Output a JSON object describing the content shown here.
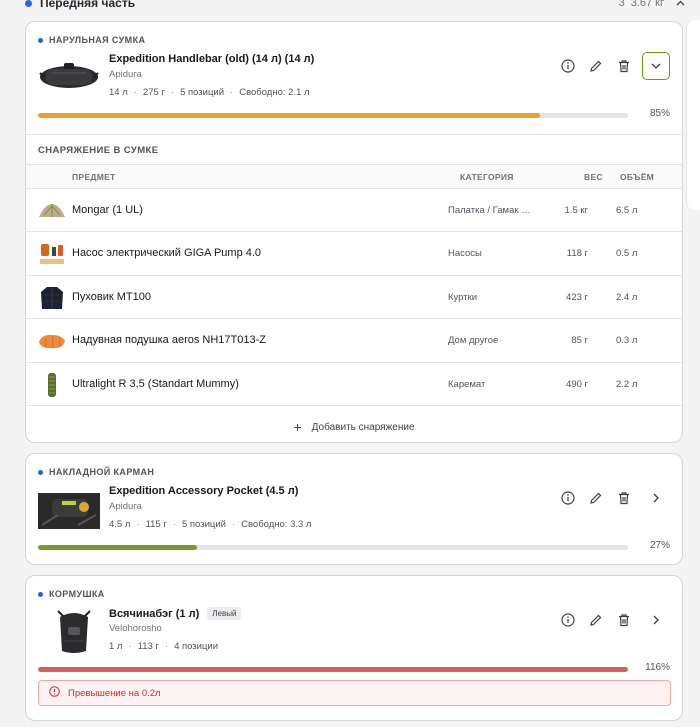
{
  "section": {
    "title": "Передняя часть",
    "count": "3",
    "weight": "3.67 кг"
  },
  "bags": [
    {
      "label": "НАРУЛЬНАЯ СУМКА",
      "name": "Expedition Handlebar (old) (14 л) (14 л)",
      "brand": "Apidura",
      "volume": "14 л",
      "weight": "275 г",
      "items": "5 позиций",
      "free": "Свободно: 2.1 л",
      "percent": "85%",
      "fill": 0.85,
      "color": "#eaa12d"
    },
    {
      "label": "НАКЛАДНОЙ КАРМАН",
      "name": "Expedition Accessory Pocket (4.5 л)",
      "brand": "Apidura",
      "volume": "4.5 л",
      "weight": "115 г",
      "items": "5 позиций",
      "free": "Свободно: 3.3 л",
      "percent": "27%",
      "fill": 0.27,
      "color": "#7a9a2e"
    },
    {
      "label": "КОРМУШКА",
      "name": "Всячинабэг (1 л)",
      "badge": "Левый",
      "brand": "Velohorosho",
      "volume": "1 л",
      "weight": "113 г",
      "items": "4 позиции",
      "percent": "116%",
      "fill": 1.0,
      "color": "#d9605a",
      "warning": "Превышение на 0.2л"
    }
  ],
  "gear": {
    "title": "СНАРЯЖЕНИЕ В СУМКЕ",
    "headers": {
      "item": "ПРЕДМЕТ",
      "category": "КАТЕГОРИЯ",
      "weight": "ВЕС",
      "volume": "ОБЪЁМ"
    },
    "rows": [
      {
        "name": "Mongar (1 UL)",
        "category": "Палатка / Гамак …",
        "weight": "1.5 кг",
        "volume": "6.5 л",
        "icon": "tent-icon"
      },
      {
        "name": "Насос электрический GIGA Pump 4.0",
        "category": "Насосы",
        "weight": "118 г",
        "volume": "0.5 л",
        "icon": "pump-icon"
      },
      {
        "name": "Пуховик MT100",
        "category": "Куртки",
        "weight": "423 г",
        "volume": "2.4 л",
        "icon": "jacket-icon"
      },
      {
        "name": "Надувная подушка aeros NH17T013-Z",
        "category": "Дом другое",
        "weight": "85 г",
        "volume": "0.3 л",
        "icon": "pillow-icon"
      },
      {
        "name": "Ultralight R 3,5 (Standart Mummy)",
        "category": "Каремат",
        "weight": "490 г",
        "volume": "2.2 л",
        "icon": "mat-icon"
      }
    ],
    "add_label": "Добавить снаряжение"
  }
}
